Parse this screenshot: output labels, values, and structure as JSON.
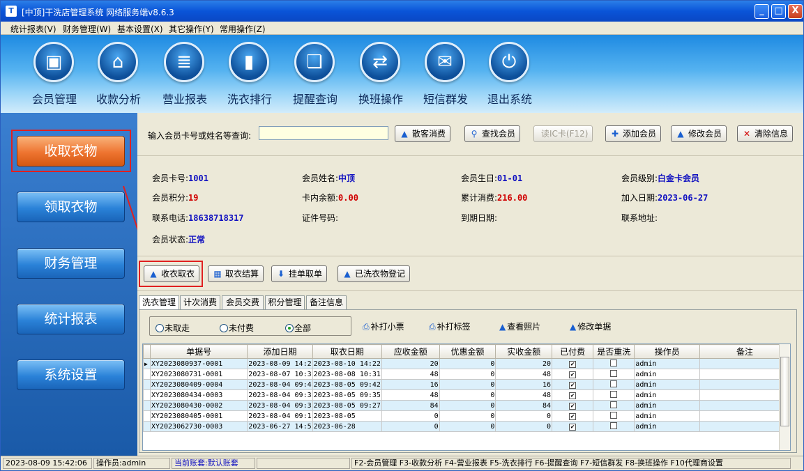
{
  "window": {
    "title": "[中顶]干洗店管理系统 网络服务端v8.6.3",
    "app_icon": "T",
    "min": "_",
    "max": "□",
    "close": "X"
  },
  "menu": [
    "统计报表(V)",
    "财务管理(W)",
    "基本设置(X)",
    "其它操作(Y)",
    "常用操作(Z)"
  ],
  "toolbar": [
    {
      "label": "会员管理",
      "icon": "member-card-icon",
      "glyph": "▣"
    },
    {
      "label": "收款分析",
      "icon": "home-icon",
      "glyph": "⌂"
    },
    {
      "label": "营业报表",
      "icon": "report-document-icon",
      "glyph": "≣"
    },
    {
      "label": "洗衣排行",
      "icon": "bar-chart-icon",
      "glyph": "▮"
    },
    {
      "label": "提醒查询",
      "icon": "speech-bubble-icon",
      "glyph": "❏"
    },
    {
      "label": "换班操作",
      "icon": "swap-arrows-icon",
      "glyph": "⇄"
    },
    {
      "label": "短信群发",
      "icon": "envelope-icon",
      "glyph": "✉"
    },
    {
      "label": "退出系统",
      "icon": "power-icon",
      "glyph": "⏻"
    }
  ],
  "sidebar": [
    "收取衣物",
    "领取衣物",
    "财务管理",
    "统计报表",
    "系统设置"
  ],
  "search": {
    "label": "输入会员卡号或姓名等查询:",
    "value": "",
    "buttons": [
      {
        "label": "散客消费",
        "glyph": "▲"
      },
      {
        "label": "查找会员",
        "glyph": "⚲"
      },
      {
        "label": "读IC卡(F12)",
        "glyph": ""
      },
      {
        "label": "添加会员",
        "glyph": "✚"
      },
      {
        "label": "修改会员",
        "glyph": "▲"
      },
      {
        "label": "清除信息",
        "glyph": "✕"
      }
    ]
  },
  "member": {
    "card_label": "会员卡号:",
    "card": "1001",
    "name_label": "会员姓名:",
    "name": "中顶",
    "birthday_label": "会员生日:",
    "birthday": "01-01",
    "level_label": "会员级别:",
    "level": "白金卡会员",
    "points_label": "会员积分:",
    "points": "19",
    "balance_label": "卡内余额:",
    "balance": "0.00",
    "total_label": "累计消费:",
    "total": "216.00",
    "join_label": "加入日期:",
    "join": "2023-06-27",
    "phone_label": "联系电话:",
    "phone": "18638718317",
    "id_label": "证件号码:",
    "id": "",
    "expire_label": "到期日期:",
    "expire": "",
    "address_label": "联系地址:",
    "address": "",
    "status_label": "会员状态:",
    "status": "正常"
  },
  "actions": [
    {
      "label": "收衣取衣",
      "glyph": "▲"
    },
    {
      "label": "取衣结算",
      "glyph": "▦"
    },
    {
      "label": "挂单取单",
      "glyph": "⬇"
    },
    {
      "label": "已洗衣物登记",
      "glyph": "▲"
    }
  ],
  "tabs": [
    "洗衣管理",
    "计次消费",
    "会员交费",
    "积分管理",
    "备注信息"
  ],
  "filters": [
    "未取走",
    "未付费",
    "全部"
  ],
  "panel_buttons": [
    {
      "label": "补打小票",
      "glyph": "⎙"
    },
    {
      "label": "补打标签",
      "glyph": "⎙"
    },
    {
      "label": "查看照片",
      "glyph": "▲"
    },
    {
      "label": "修改单据",
      "glyph": "▲"
    }
  ],
  "table": {
    "columns": [
      "单据号",
      "添加日期",
      "取衣日期",
      "应收金额",
      "优惠金额",
      "实收金额",
      "已付费",
      "是否重洗",
      "操作员",
      "备注"
    ],
    "rows": [
      [
        "XY2023080937-0001",
        "2023-08-09 14:2",
        "2023-08-10 14:22",
        "20",
        "0",
        "20",
        true,
        false,
        "admin",
        ""
      ],
      [
        "XY2023080731-0001",
        "2023-08-07 10:3",
        "2023-08-08 10:31",
        "48",
        "0",
        "48",
        true,
        false,
        "admin",
        ""
      ],
      [
        "XY2023080409-0004",
        "2023-08-04 09:4",
        "2023-08-05 09:42",
        "16",
        "0",
        "16",
        true,
        false,
        "admin",
        ""
      ],
      [
        "XY2023080434-0003",
        "2023-08-04 09:3",
        "2023-08-05 09:35",
        "48",
        "0",
        "48",
        true,
        false,
        "admin",
        ""
      ],
      [
        "XY2023080430-0002",
        "2023-08-04 09:3",
        "2023-08-05 09:27",
        "84",
        "0",
        "84",
        true,
        false,
        "admin",
        ""
      ],
      [
        "XY2023080405-0001",
        "2023-08-04 09:1",
        "2023-08-05",
        "0",
        "0",
        "0",
        true,
        false,
        "admin",
        ""
      ],
      [
        "XY2023062730-0003",
        "2023-06-27 14:5",
        "2023-06-28",
        "0",
        "0",
        "0",
        true,
        false,
        "admin",
        ""
      ]
    ]
  },
  "status": {
    "time": "2023-08-09 15:42:06",
    "operator": "操作员:admin",
    "account": "当前账套:默认账套",
    "hotkeys": "F2-会员管理 F3-收款分析 F4-营业报表 F5-洗衣排行 F6-提醒查询 F7-短信群发 F8-换班操作 F10代理商设置"
  },
  "row_pointer": "▶",
  "checkmark": "✔",
  "colors": {
    "accent_blue": "#1010c0",
    "value_red": "#d00000",
    "active_orange": "#ee7430",
    "highlight_red": "#e02020"
  }
}
